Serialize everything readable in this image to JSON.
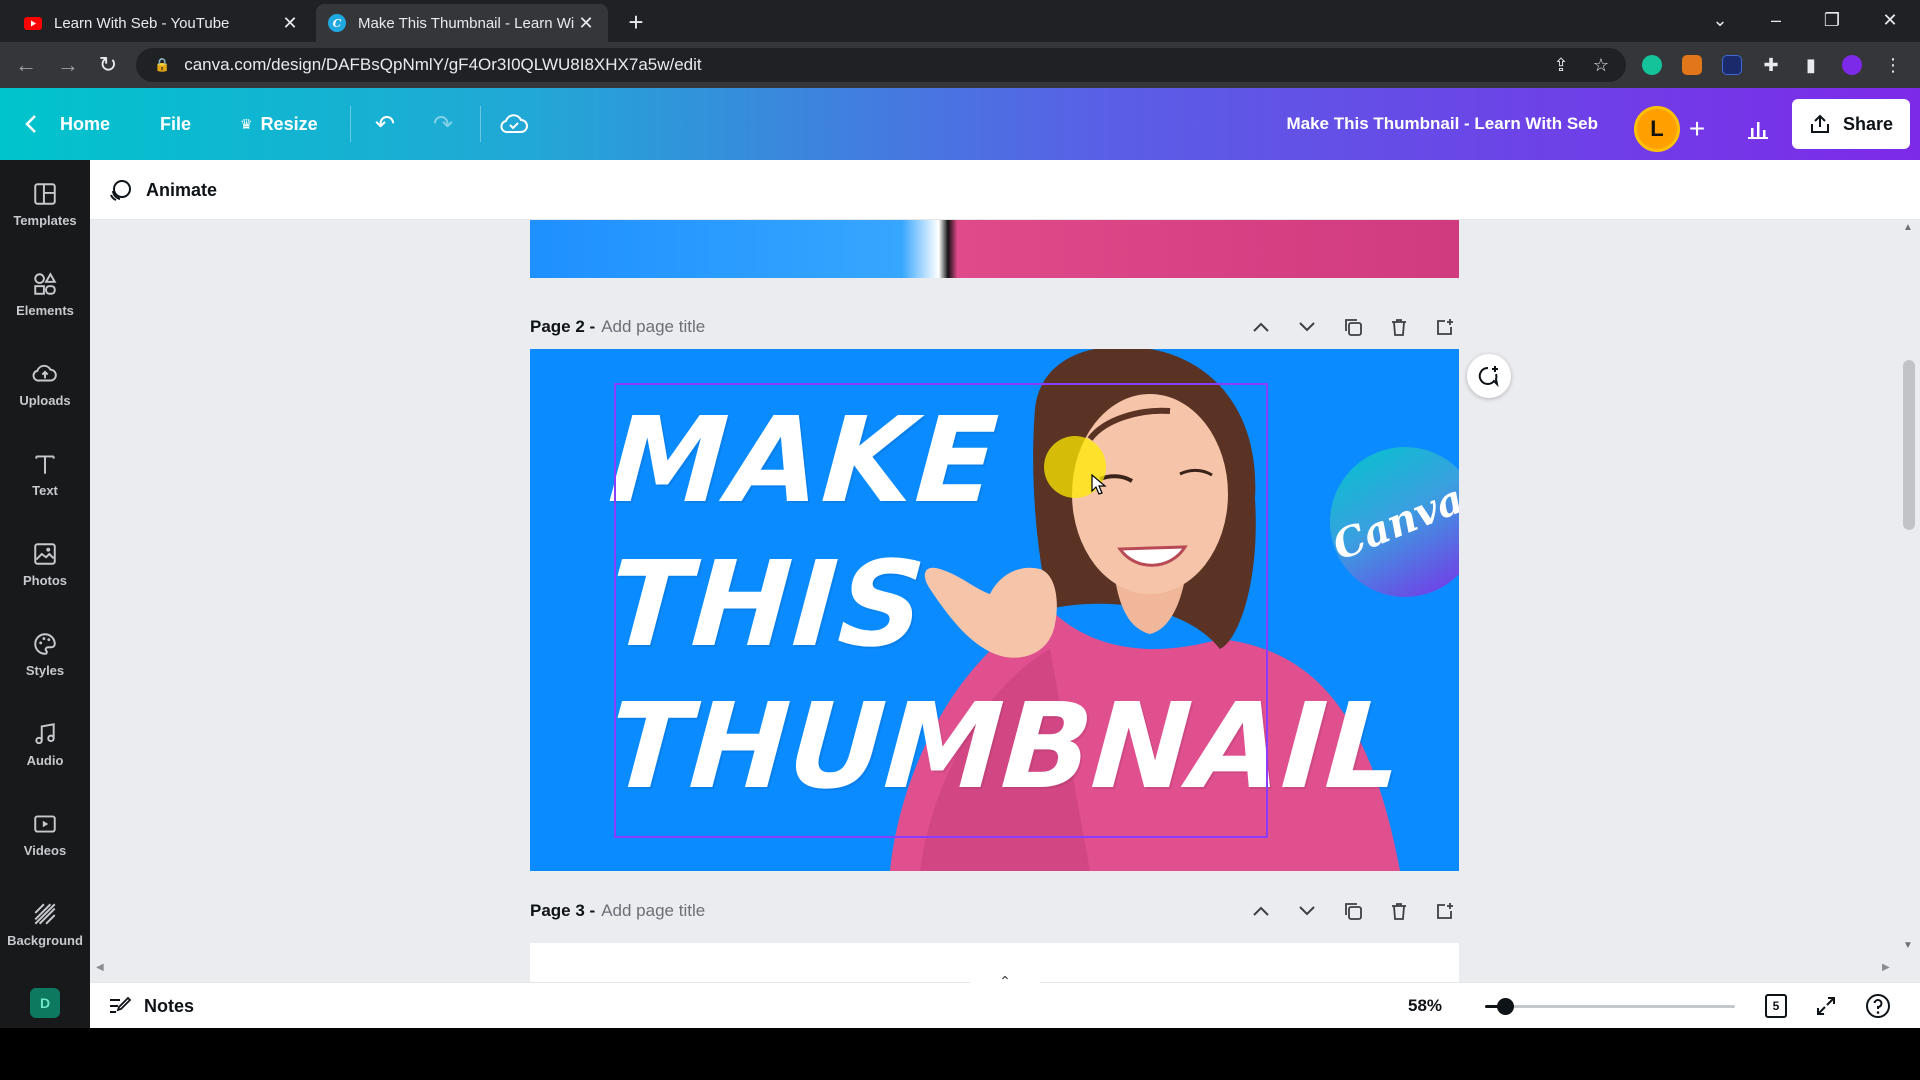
{
  "browser": {
    "tabs": [
      {
        "title": "Learn With Seb - YouTube",
        "favicon": "youtube-icon",
        "active": false
      },
      {
        "title": "Make This Thumbnail - Learn Wi",
        "favicon": "canva-icon",
        "active": true
      }
    ],
    "url": "canva.com/design/DAFBsQpNmlY/gF4Or3I0QLWU8I8XHX7a5w/edit"
  },
  "topbar": {
    "home": "Home",
    "file": "File",
    "resize": "Resize",
    "doc_title": "Make This Thumbnail - Learn With Seb",
    "avatar_initial": "L",
    "share": "Share"
  },
  "sidebar": {
    "items": [
      {
        "label": "Templates",
        "icon": "templates-icon"
      },
      {
        "label": "Elements",
        "icon": "elements-icon"
      },
      {
        "label": "Uploads",
        "icon": "uploads-icon"
      },
      {
        "label": "Text",
        "icon": "text-icon"
      },
      {
        "label": "Photos",
        "icon": "photos-icon"
      },
      {
        "label": "Styles",
        "icon": "styles-icon"
      },
      {
        "label": "Audio",
        "icon": "audio-icon"
      },
      {
        "label": "Videos",
        "icon": "videos-icon"
      },
      {
        "label": "Background",
        "icon": "background-icon"
      }
    ]
  },
  "toolbar": {
    "animate": "Animate"
  },
  "pages": [
    {
      "label": "Page 2 -",
      "placeholder": "Add page title"
    },
    {
      "label": "Page 3 -",
      "placeholder": "Add page title"
    }
  ],
  "design": {
    "line1": "MAKE",
    "line2": "THIS",
    "line3": "THUMBNAIL",
    "badge": "Canva",
    "background_color": "#0a8bff"
  },
  "bottombar": {
    "notes": "Notes",
    "zoom": "58%",
    "zoom_level": 0.08,
    "page_count": "5"
  },
  "colors": {
    "accent_gradient_start": "#00c4cc",
    "accent_gradient_end": "#7d2ae8",
    "selection": "#8b3dff"
  }
}
